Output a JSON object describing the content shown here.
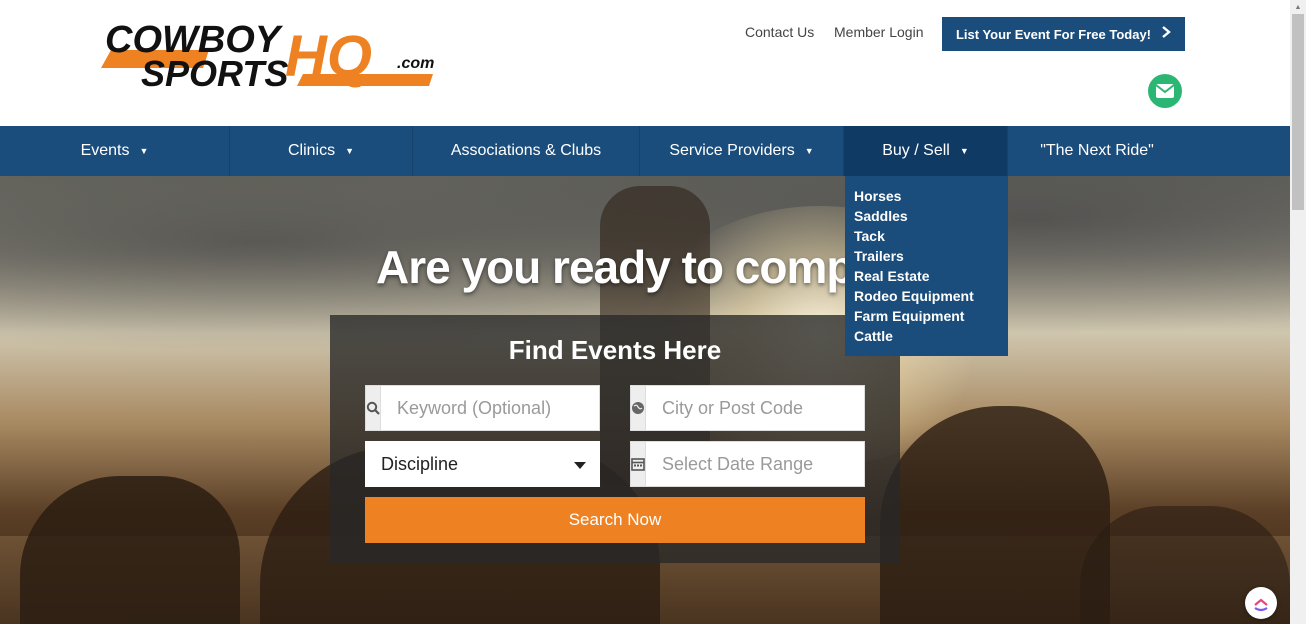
{
  "header": {
    "logo": {
      "line1": "COWBOY",
      "line2": "SPORTS",
      "hq": "HQ",
      "com": ".com"
    },
    "links": {
      "contact": "Contact Us",
      "login": "Member Login"
    },
    "cta_label": "List Your Event For Free Today!",
    "cta_icon": "chevron-right-icon",
    "mail_icon": "envelope-icon"
  },
  "nav": {
    "items": [
      {
        "label": "Events",
        "caret": "▼"
      },
      {
        "label": "Clinics",
        "caret": "▼"
      },
      {
        "label": "Associations & Clubs"
      },
      {
        "label": "Service Providers",
        "caret": "▼"
      },
      {
        "label": "Buy / Sell",
        "caret": "▼"
      },
      {
        "label": "\"The Next Ride\""
      }
    ]
  },
  "dropdown": {
    "items": [
      "Horses",
      "Saddles",
      "Tack",
      "Trailers",
      "Real Estate",
      "Rodeo Equipment",
      "Farm Equipment",
      "Cattle"
    ]
  },
  "hero": {
    "headline": "Are you ready to compete?"
  },
  "search": {
    "title": "Find Events Here",
    "keyword_placeholder": "Keyword (Optional)",
    "location_placeholder": "City or Post Code",
    "discipline_value": "Discipline",
    "date_placeholder": "Select Date Range",
    "button_label": "Search Now"
  },
  "colors": {
    "nav_bg": "#1a4d7c",
    "accent_orange": "#ee8121",
    "mail_green": "#2bb673"
  }
}
